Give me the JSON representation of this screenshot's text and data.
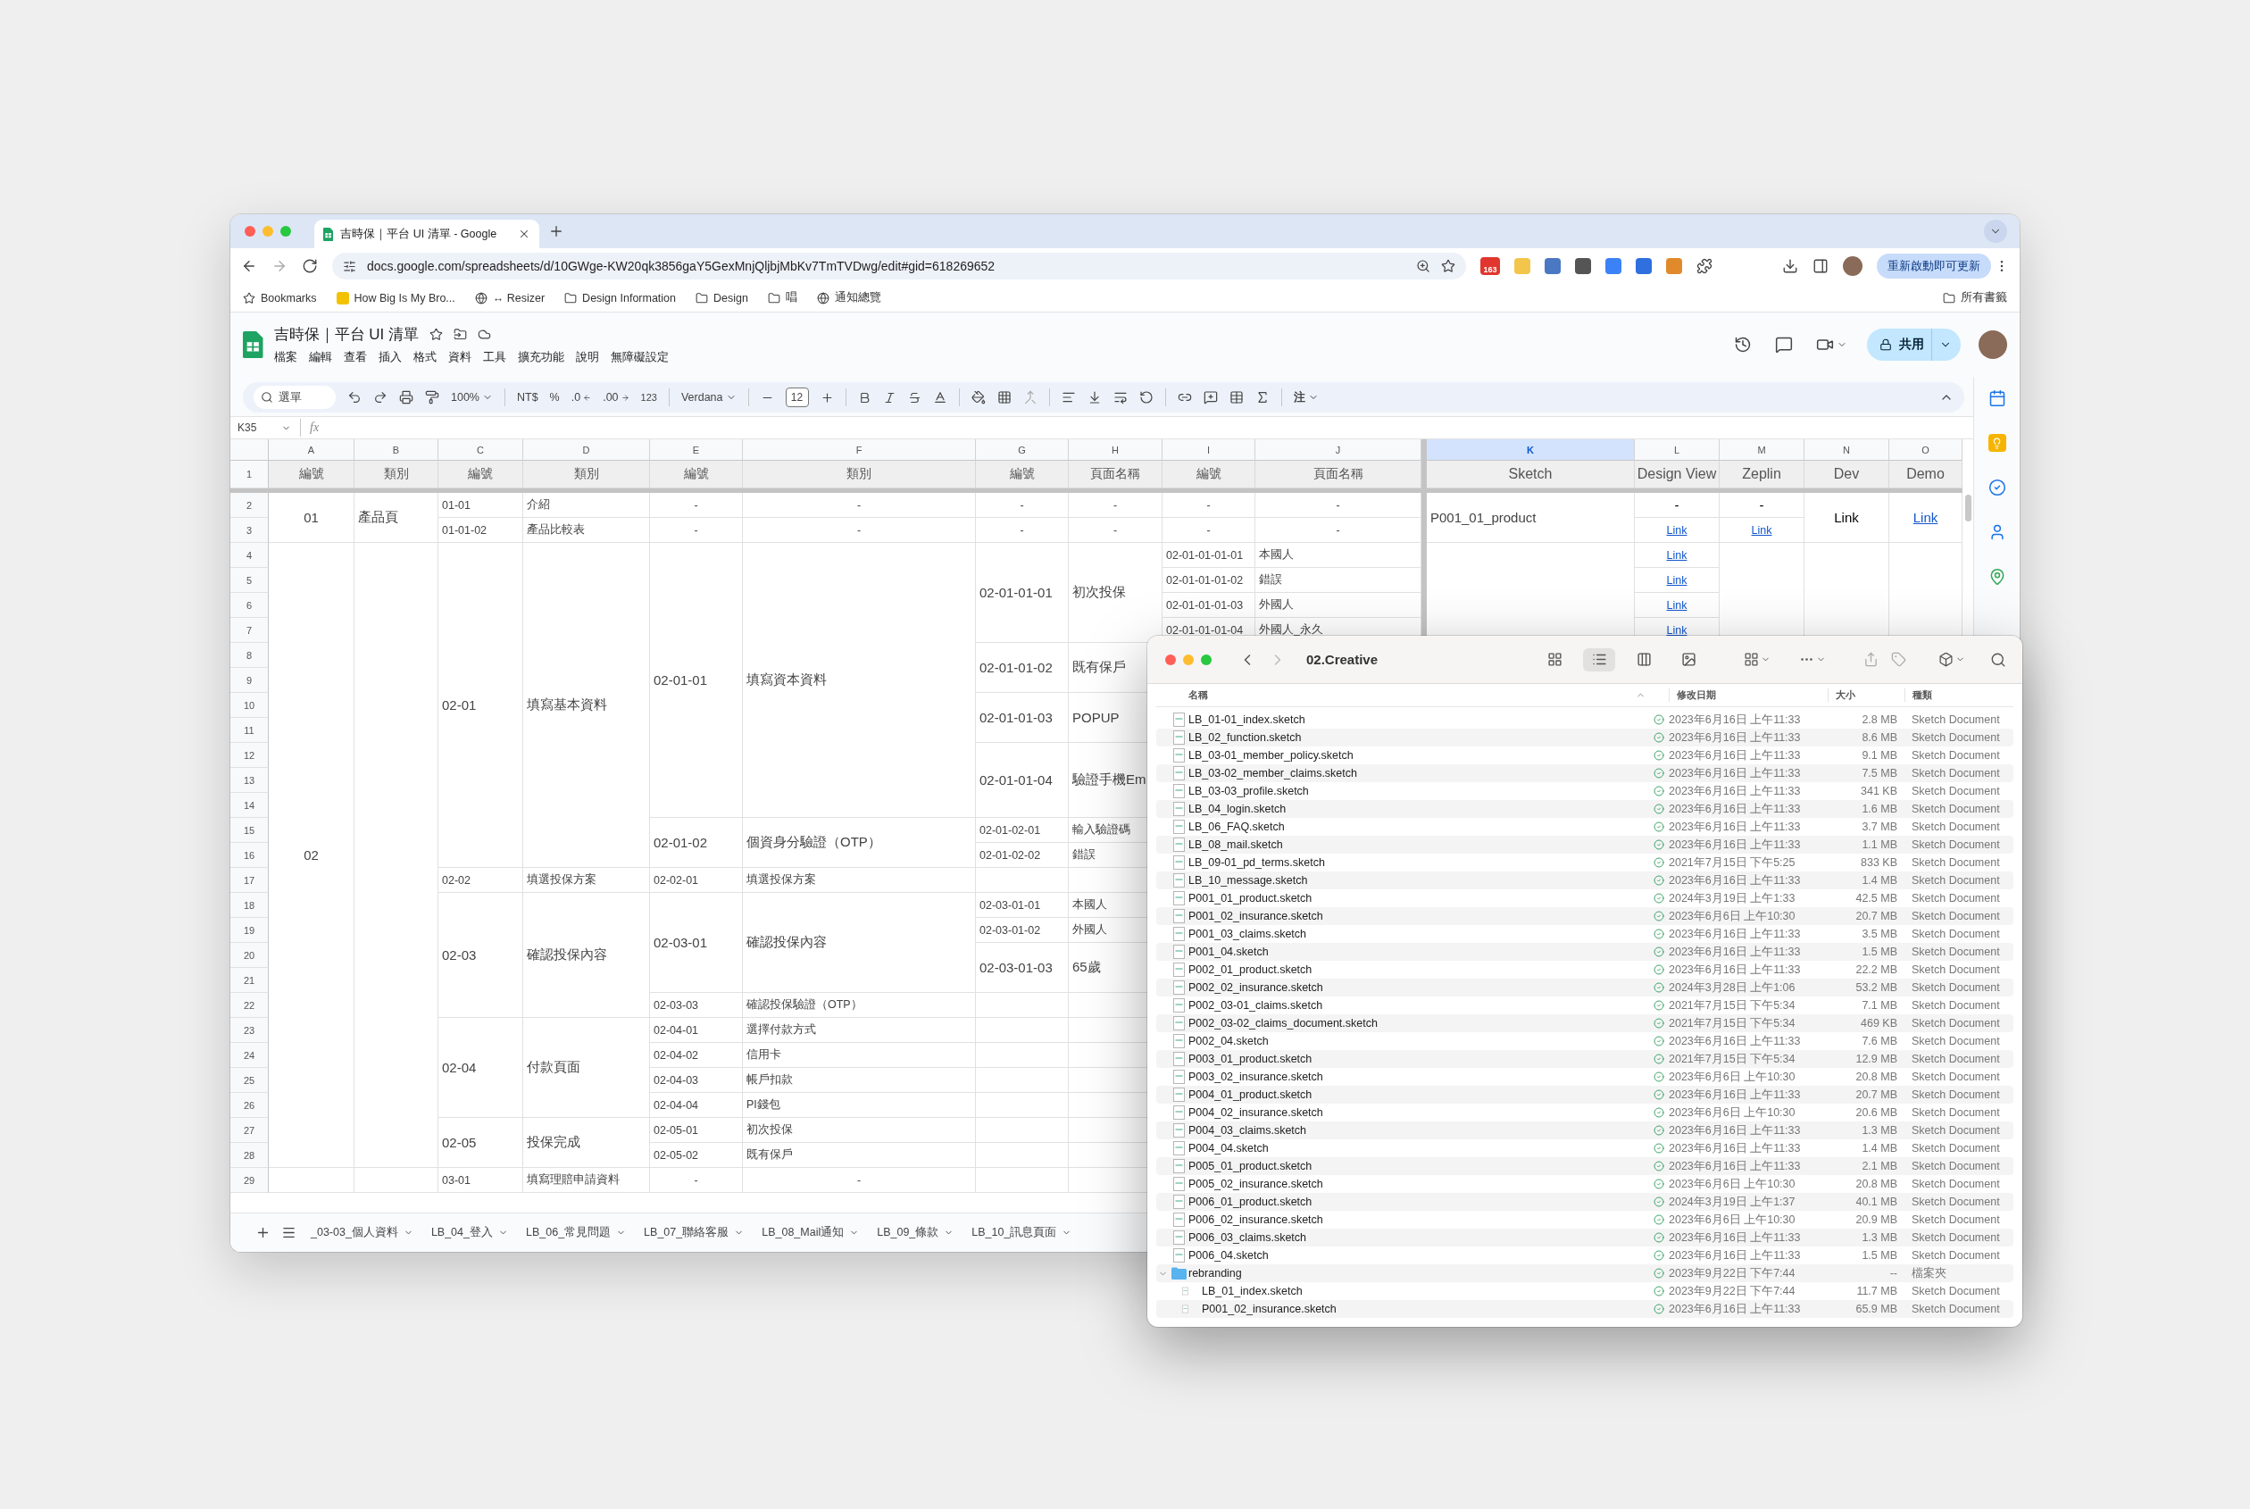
{
  "browser": {
    "tab": {
      "title": "吉時保｜平台 UI 清單 - Google"
    },
    "url": "docs.google.com/spreadsheets/d/10GWge-KW20qk3856gaY5GexMnjQljbjMbKv7TmTVDwg/edit#gid=618269652",
    "extension_badge": "163",
    "update_button": "重新啟動即可更新",
    "bookmarks": [
      {
        "label": "Bookmarks",
        "kind": "star"
      },
      {
        "label": "How Big Is My Bro...",
        "kind": "site"
      },
      {
        "label": "↔ Resizer",
        "kind": "globe"
      },
      {
        "label": "Design Information",
        "kind": "folder"
      },
      {
        "label": "Design",
        "kind": "folder"
      },
      {
        "label": "唱",
        "kind": "folder"
      },
      {
        "label": "通知總覽",
        "kind": "globe"
      }
    ],
    "all_bookmarks": "所有書籤"
  },
  "sheets": {
    "title": "吉時保｜平台 UI 清單",
    "menu": [
      "檔案",
      "編輯",
      "查看",
      "插入",
      "格式",
      "資料",
      "工具",
      "擴充功能",
      "說明",
      "無障礙設定"
    ],
    "share": "共用",
    "toolbar": {
      "search": "選單",
      "zoom": "100%",
      "currency": "NT$",
      "percent": "%",
      "decimal_less": ".0",
      "decimal_more": ".00",
      "number_format": "123",
      "font": "Verdana",
      "font_size": "12",
      "input_tool": "注"
    },
    "name_box": "K35",
    "formula_label": "fx",
    "row_numbers": [
      "1",
      "2",
      "3",
      "4",
      "5",
      "6",
      "7",
      "8",
      "9",
      "10",
      "11",
      "12",
      "13",
      "14",
      "15",
      "16",
      "17",
      "18",
      "19",
      "20",
      "21",
      "22",
      "23",
      "24",
      "25",
      "26",
      "27",
      "28",
      "29"
    ],
    "columns": [
      {
        "letter": "A",
        "selected": false,
        "header": "編號",
        "cells": [
          {
            "text": "01",
            "kind": "center"
          },
          {
            "kind": "merged"
          },
          {
            "text": "02",
            "kind": "center"
          },
          {
            "kind": "merged"
          },
          {
            "kind": "merged"
          },
          {
            "kind": "merged"
          },
          {
            "kind": "merged"
          },
          {
            "kind": "merged"
          },
          {
            "kind": "merged"
          },
          {
            "kind": "merged"
          },
          {
            "kind": "merged"
          },
          {
            "kind": "merged"
          },
          {
            "kind": "merged"
          },
          {
            "kind": "merged"
          },
          {
            "kind": "merged"
          },
          {
            "kind": "merged"
          },
          {
            "kind": "merged"
          },
          {
            "kind": "merged"
          },
          {
            "kind": "merged"
          },
          {
            "kind": "merged"
          },
          {
            "kind": "merged"
          },
          {
            "kind": "merged"
          },
          {
            "kind": "merged"
          },
          {
            "kind": "merged"
          },
          {
            "kind": "merged"
          },
          {
            "kind": "merged"
          },
          {
            "kind": "merged"
          },
          {
            "kind": "empty"
          }
        ]
      },
      {
        "letter": "B",
        "selected": false,
        "header": "類別",
        "cells": [
          {
            "text": "產品頁",
            "kind": "text"
          },
          {
            "kind": "merged"
          },
          {
            "kind": "empty"
          },
          {
            "kind": "merged"
          },
          {
            "kind": "merged"
          },
          {
            "kind": "merged"
          },
          {
            "kind": "merged"
          },
          {
            "kind": "merged"
          },
          {
            "kind": "merged"
          },
          {
            "kind": "merged"
          },
          {
            "kind": "merged"
          },
          {
            "kind": "merged"
          },
          {
            "kind": "merged"
          },
          {
            "kind": "merged"
          },
          {
            "kind": "merged"
          },
          {
            "kind": "merged"
          },
          {
            "kind": "merged"
          },
          {
            "kind": "merged"
          },
          {
            "kind": "merged"
          },
          {
            "kind": "merged"
          },
          {
            "kind": "merged"
          },
          {
            "kind": "merged"
          },
          {
            "kind": "merged"
          },
          {
            "kind": "merged"
          },
          {
            "kind": "merged"
          },
          {
            "kind": "merged"
          },
          {
            "kind": "merged"
          },
          {
            "kind": "empty"
          }
        ]
      },
      {
        "letter": "C",
        "selected": false,
        "header": "編號",
        "cells": [
          {
            "text": "01-01",
            "kind": "text"
          },
          {
            "text": "01-01-02",
            "kind": "text"
          },
          {
            "text": "02-01",
            "kind": "text"
          },
          {
            "kind": "merged"
          },
          {
            "kind": "merged"
          },
          {
            "kind": "merged"
          },
          {
            "kind": "merged"
          },
          {
            "kind": "merged"
          },
          {
            "kind": "merged"
          },
          {
            "kind": "merged"
          },
          {
            "kind": "merged"
          },
          {
            "kind": "merged"
          },
          {
            "kind": "merged"
          },
          {
            "kind": "merged"
          },
          {
            "kind": "merged"
          },
          {
            "text": "02-02",
            "kind": "text"
          },
          {
            "text": "02-03",
            "kind": "text"
          },
          {
            "kind": "merged"
          },
          {
            "kind": "merged"
          },
          {
            "kind": "merged"
          },
          {
            "kind": "merged"
          },
          {
            "text": "02-04",
            "kind": "text"
          },
          {
            "kind": "merged"
          },
          {
            "kind": "merged"
          },
          {
            "kind": "merged"
          },
          {
            "text": "02-05",
            "kind": "text"
          },
          {
            "kind": "merged"
          },
          {
            "text": "03-01",
            "kind": "text"
          }
        ]
      },
      {
        "letter": "D",
        "selected": false,
        "header": "類別",
        "cells": [
          {
            "text": "介紹",
            "kind": "text"
          },
          {
            "text": "產品比較表",
            "kind": "text"
          },
          {
            "text": "填寫基本資料",
            "kind": "text"
          },
          {
            "kind": "merged"
          },
          {
            "kind": "merged"
          },
          {
            "kind": "merged"
          },
          {
            "kind": "merged"
          },
          {
            "kind": "merged"
          },
          {
            "kind": "merged"
          },
          {
            "kind": "merged"
          },
          {
            "kind": "merged"
          },
          {
            "kind": "merged"
          },
          {
            "kind": "merged"
          },
          {
            "kind": "merged"
          },
          {
            "kind": "merged"
          },
          {
            "text": "填選投保方案",
            "kind": "text"
          },
          {
            "text": "確認投保內容",
            "kind": "text"
          },
          {
            "kind": "merged"
          },
          {
            "kind": "merged"
          },
          {
            "kind": "merged"
          },
          {
            "kind": "merged"
          },
          {
            "text": "付款頁面",
            "kind": "text"
          },
          {
            "kind": "merged"
          },
          {
            "kind": "merged"
          },
          {
            "kind": "merged"
          },
          {
            "text": "投保完成",
            "kind": "text"
          },
          {
            "kind": "merged"
          },
          {
            "text": "填寫理賠申請資料",
            "kind": "text"
          }
        ]
      },
      {
        "letter": "E",
        "selected": false,
        "header": "編號",
        "cells": [
          {
            "text": "-",
            "kind": "center"
          },
          {
            "text": "-",
            "kind": "center"
          },
          {
            "text": "02-01-01",
            "kind": "text"
          },
          {
            "kind": "merged"
          },
          {
            "kind": "merged"
          },
          {
            "kind": "merged"
          },
          {
            "kind": "merged"
          },
          {
            "kind": "merged"
          },
          {
            "kind": "merged"
          },
          {
            "kind": "merged"
          },
          {
            "kind": "merged"
          },
          {
            "kind": "merged"
          },
          {
            "kind": "merged"
          },
          {
            "text": "02-01-02",
            "kind": "text"
          },
          {
            "kind": "merged"
          },
          {
            "text": "02-02-01",
            "kind": "text"
          },
          {
            "text": "02-03-01",
            "kind": "text"
          },
          {
            "kind": "merged"
          },
          {
            "kind": "merged"
          },
          {
            "kind": "merged"
          },
          {
            "text": "02-03-03",
            "kind": "text"
          },
          {
            "text": "02-04-01",
            "kind": "text"
          },
          {
            "text": "02-04-02",
            "kind": "text"
          },
          {
            "text": "02-04-03",
            "kind": "text"
          },
          {
            "text": "02-04-04",
            "kind": "text"
          },
          {
            "text": "02-05-01",
            "kind": "text"
          },
          {
            "text": "02-05-02",
            "kind": "text"
          },
          {
            "text": "-",
            "kind": "center"
          }
        ]
      },
      {
        "letter": "F",
        "selected": false,
        "header": "類別",
        "cells": [
          {
            "text": "-",
            "kind": "center"
          },
          {
            "text": "-",
            "kind": "center"
          },
          {
            "text": "填寫資本資料",
            "kind": "text"
          },
          {
            "kind": "merged"
          },
          {
            "kind": "merged"
          },
          {
            "kind": "merged"
          },
          {
            "kind": "merged"
          },
          {
            "kind": "merged"
          },
          {
            "kind": "merged"
          },
          {
            "kind": "merged"
          },
          {
            "kind": "merged"
          },
          {
            "kind": "merged"
          },
          {
            "kind": "merged"
          },
          {
            "text": "個資身分驗證（OTP）",
            "kind": "text"
          },
          {
            "kind": "merged"
          },
          {
            "text": "填選投保方案",
            "kind": "text"
          },
          {
            "text": "確認投保內容",
            "kind": "text"
          },
          {
            "kind": "merged"
          },
          {
            "kind": "merged"
          },
          {
            "kind": "merged"
          },
          {
            "text": "確認投保驗證（OTP）",
            "kind": "text"
          },
          {
            "text": "選擇付款方式",
            "kind": "text"
          },
          {
            "text": "信用卡",
            "kind": "text"
          },
          {
            "text": "帳戶扣款",
            "kind": "text"
          },
          {
            "text": "PI錢包",
            "kind": "text"
          },
          {
            "text": "初次投保",
            "kind": "text"
          },
          {
            "text": "既有保戶",
            "kind": "text"
          },
          {
            "text": "-",
            "kind": "center"
          }
        ]
      },
      {
        "letter": "G",
        "selected": false,
        "header": "編號",
        "cells": [
          {
            "text": "-",
            "kind": "center"
          },
          {
            "text": "-",
            "kind": "center"
          },
          {
            "text": "02-01-01-01",
            "kind": "text"
          },
          {
            "kind": "merged"
          },
          {
            "kind": "merged"
          },
          {
            "kind": "merged"
          },
          {
            "text": "02-01-01-02",
            "kind": "text"
          },
          {
            "kind": "merged"
          },
          {
            "text": "02-01-01-03",
            "kind": "text"
          },
          {
            "kind": "merged"
          },
          {
            "text": "02-01-01-04",
            "kind": "text"
          },
          {
            "kind": "merged"
          },
          {
            "kind": "merged"
          },
          {
            "text": "02-01-02-01",
            "kind": "text"
          },
          {
            "text": "02-01-02-02",
            "kind": "text"
          },
          {
            "kind": "empty"
          },
          {
            "text": "02-03-01-01",
            "kind": "text"
          },
          {
            "text": "02-03-01-02",
            "kind": "text"
          },
          {
            "text": "02-03-01-03",
            "kind": "text"
          },
          {
            "kind": "merged"
          },
          {
            "kind": "empty"
          },
          {
            "kind": "empty"
          },
          {
            "kind": "empty"
          },
          {
            "kind": "empty"
          },
          {
            "kind": "empty"
          },
          {
            "kind": "empty"
          },
          {
            "kind": "empty"
          },
          {
            "kind": "empty"
          }
        ]
      },
      {
        "letter": "H",
        "selected": false,
        "header": "頁面名稱",
        "cells": [
          {
            "text": "-",
            "kind": "center"
          },
          {
            "text": "-",
            "kind": "center"
          },
          {
            "text": "初次投保",
            "kind": "text"
          },
          {
            "kind": "merged"
          },
          {
            "kind": "merged"
          },
          {
            "kind": "merged"
          },
          {
            "text": "既有保戶",
            "kind": "text"
          },
          {
            "kind": "merged"
          },
          {
            "text": "POPUP",
            "kind": "text"
          },
          {
            "kind": "merged"
          },
          {
            "text": "驗證手機Em",
            "kind": "text"
          },
          {
            "kind": "merged"
          },
          {
            "kind": "merged"
          },
          {
            "text": "輸入驗證碼",
            "kind": "text"
          },
          {
            "text": "錯誤",
            "kind": "text"
          },
          {
            "kind": "empty"
          },
          {
            "text": "本國人",
            "kind": "text"
          },
          {
            "text": "外國人",
            "kind": "text"
          },
          {
            "text": "65歲",
            "kind": "text"
          },
          {
            "kind": "merged"
          },
          {
            "kind": "empty"
          },
          {
            "kind": "empty"
          },
          {
            "kind": "empty"
          },
          {
            "kind": "empty"
          },
          {
            "kind": "empty"
          },
          {
            "kind": "empty"
          },
          {
            "kind": "empty"
          },
          {
            "kind": "empty"
          }
        ]
      },
      {
        "letter": "I",
        "selected": false,
        "header": "編號",
        "cells": [
          {
            "text": "-",
            "kind": "center"
          },
          {
            "text": "-",
            "kind": "center"
          },
          {
            "text": "02-01-01-01-01",
            "kind": "text"
          },
          {
            "text": "02-01-01-01-02",
            "kind": "text"
          },
          {
            "text": "02-01-01-01-03",
            "kind": "text"
          },
          {
            "text": "02-01-01-01-04",
            "kind": "text"
          }
        ]
      },
      {
        "letter": "J",
        "selected": false,
        "header": "頁面名稱",
        "cells": [
          {
            "text": "-",
            "kind": "center"
          },
          {
            "text": "-",
            "kind": "center"
          },
          {
            "text": "本國人",
            "kind": "text"
          },
          {
            "text": "錯誤",
            "kind": "text"
          },
          {
            "text": "外國人",
            "kind": "text"
          },
          {
            "text": "外國人_永久",
            "kind": "text"
          }
        ]
      },
      {
        "letter": "K",
        "selected": true,
        "header": "Sketch",
        "cells": [
          {
            "text": "P001_01_product",
            "kind": "text"
          },
          {
            "kind": "merged"
          },
          {
            "kind": "empty"
          },
          {
            "kind": "merged"
          },
          {
            "kind": "merged"
          },
          {
            "kind": "merged"
          }
        ]
      },
      {
        "letter": "L",
        "selected": false,
        "header": "Design View",
        "cells": [
          {
            "text": "-",
            "kind": "center"
          },
          {
            "text": "Link",
            "kind": "link"
          },
          {
            "text": "Link",
            "kind": "link"
          },
          {
            "text": "Link",
            "kind": "link"
          },
          {
            "text": "Link",
            "kind": "link"
          },
          {
            "text": "Link",
            "kind": "link"
          }
        ]
      },
      {
        "letter": "M",
        "selected": false,
        "header": "Zeplin",
        "cells": [
          {
            "text": "-",
            "kind": "center"
          },
          {
            "text": "Link",
            "kind": "link"
          },
          {
            "kind": "empty"
          },
          {
            "kind": "merged"
          },
          {
            "kind": "merged"
          },
          {
            "kind": "merged"
          }
        ]
      },
      {
        "letter": "N",
        "selected": false,
        "header": "Dev",
        "cells": [
          {
            "text": "Link",
            "kind": "center"
          },
          {
            "kind": "merged"
          },
          {
            "kind": "empty"
          },
          {
            "kind": "merged"
          },
          {
            "kind": "merged"
          },
          {
            "kind": "merged"
          }
        ]
      },
      {
        "letter": "O",
        "selected": false,
        "header": "Demo",
        "cells": [
          {
            "text": "Link",
            "kind": "link"
          },
          {
            "kind": "merged"
          },
          {
            "kind": "empty"
          },
          {
            "kind": "merged"
          },
          {
            "kind": "merged"
          },
          {
            "kind": "merged"
          }
        ]
      }
    ],
    "sheet_tabs": [
      {
        "label": "_03-03_個人資料",
        "selected": false
      },
      {
        "label": "LB_04_登入",
        "selected": false
      },
      {
        "label": "LB_06_常見問題",
        "selected": false
      },
      {
        "label": "LB_07_聯絡客服",
        "selected": false
      },
      {
        "label": "LB_08_Mail通知",
        "selected": false
      },
      {
        "label": "LB_09_條款",
        "selected": false
      },
      {
        "label": "LB_10_訊息頁面",
        "selected": false
      }
    ]
  },
  "finder": {
    "title": "02.Creative",
    "back": {
      "disabled": false
    },
    "forward": {
      "disabled": true
    },
    "views": [
      {
        "kind": "icons",
        "selected": false
      },
      {
        "kind": "list",
        "selected": true
      },
      {
        "kind": "columns",
        "selected": false
      },
      {
        "kind": "gallery",
        "selected": false
      }
    ],
    "headers": {
      "name": "名稱",
      "date": "修改日期",
      "size": "大小",
      "type": "種類"
    },
    "items": [
      {
        "name": "LB_01-01_index.sketch",
        "date": "2023年6月16日 上午11:33",
        "size": "2.8 MB",
        "type": "Sketch Document",
        "kind": "file"
      },
      {
        "name": "LB_02_function.sketch",
        "date": "2023年6月16日 上午11:33",
        "size": "8.6 MB",
        "type": "Sketch Document",
        "kind": "file"
      },
      {
        "name": "LB_03-01_member_policy.sketch",
        "date": "2023年6月16日 上午11:33",
        "size": "9.1 MB",
        "type": "Sketch Document",
        "kind": "file"
      },
      {
        "name": "LB_03-02_member_claims.sketch",
        "date": "2023年6月16日 上午11:33",
        "size": "7.5 MB",
        "type": "Sketch Document",
        "kind": "file"
      },
      {
        "name": "LB_03-03_profile.sketch",
        "date": "2023年6月16日 上午11:33",
        "size": "341 KB",
        "type": "Sketch Document",
        "kind": "file"
      },
      {
        "name": "LB_04_login.sketch",
        "date": "2023年6月16日 上午11:33",
        "size": "1.6 MB",
        "type": "Sketch Document",
        "kind": "file"
      },
      {
        "name": "LB_06_FAQ.sketch",
        "date": "2023年6月16日 上午11:33",
        "size": "3.7 MB",
        "type": "Sketch Document",
        "kind": "file"
      },
      {
        "name": "LB_08_mail.sketch",
        "date": "2023年6月16日 上午11:33",
        "size": "1.1 MB",
        "type": "Sketch Document",
        "kind": "file"
      },
      {
        "name": "LB_09-01_pd_terms.sketch",
        "date": "2021年7月15日 下午5:25",
        "size": "833 KB",
        "type": "Sketch Document",
        "kind": "file"
      },
      {
        "name": "LB_10_message.sketch",
        "date": "2023年6月16日 上午11:33",
        "size": "1.4 MB",
        "type": "Sketch Document",
        "kind": "file"
      },
      {
        "name": "P001_01_product.sketch",
        "date": "2024年3月19日 上午1:33",
        "size": "42.5 MB",
        "type": "Sketch Document",
        "kind": "file"
      },
      {
        "name": "P001_02_insurance.sketch",
        "date": "2023年6月6日 上午10:30",
        "size": "20.7 MB",
        "type": "Sketch Document",
        "kind": "file"
      },
      {
        "name": "P001_03_claims.sketch",
        "date": "2023年6月16日 上午11:33",
        "size": "3.5 MB",
        "type": "Sketch Document",
        "kind": "file"
      },
      {
        "name": "P001_04.sketch",
        "date": "2023年6月16日 上午11:33",
        "size": "1.5 MB",
        "type": "Sketch Document",
        "kind": "file"
      },
      {
        "name": "P002_01_product.sketch",
        "date": "2023年6月16日 上午11:33",
        "size": "22.2 MB",
        "type": "Sketch Document",
        "kind": "file"
      },
      {
        "name": "P002_02_insurance.sketch",
        "date": "2024年3月28日 上午1:06",
        "size": "53.2 MB",
        "type": "Sketch Document",
        "kind": "file"
      },
      {
        "name": "P002_03-01_claims.sketch",
        "date": "2021年7月15日 下午5:34",
        "size": "7.1 MB",
        "type": "Sketch Document",
        "kind": "file"
      },
      {
        "name": "P002_03-02_claims_document.sketch",
        "date": "2021年7月15日 下午5:34",
        "size": "469 KB",
        "type": "Sketch Document",
        "kind": "file"
      },
      {
        "name": "P002_04.sketch",
        "date": "2023年6月16日 上午11:33",
        "size": "7.6 MB",
        "type": "Sketch Document",
        "kind": "file"
      },
      {
        "name": "P003_01_product.sketch",
        "date": "2021年7月15日 下午5:34",
        "size": "12.9 MB",
        "type": "Sketch Document",
        "kind": "file"
      },
      {
        "name": "P003_02_insurance.sketch",
        "date": "2023年6月6日 上午10:30",
        "size": "20.8 MB",
        "type": "Sketch Document",
        "kind": "file"
      },
      {
        "name": "P004_01_product.sketch",
        "date": "2023年6月16日 上午11:33",
        "size": "20.7 MB",
        "type": "Sketch Document",
        "kind": "file"
      },
      {
        "name": "P004_02_insurance.sketch",
        "date": "2023年6月6日 上午10:30",
        "size": "20.6 MB",
        "type": "Sketch Document",
        "kind": "file"
      },
      {
        "name": "P004_03_claims.sketch",
        "date": "2023年6月16日 上午11:33",
        "size": "1.3 MB",
        "type": "Sketch Document",
        "kind": "file"
      },
      {
        "name": "P004_04.sketch",
        "date": "2023年6月16日 上午11:33",
        "size": "1.4 MB",
        "type": "Sketch Document",
        "kind": "file"
      },
      {
        "name": "P005_01_product.sketch",
        "date": "2023年6月16日 上午11:33",
        "size": "2.1 MB",
        "type": "Sketch Document",
        "kind": "file"
      },
      {
        "name": "P005_02_insurance.sketch",
        "date": "2023年6月6日 上午10:30",
        "size": "20.8 MB",
        "type": "Sketch Document",
        "kind": "file"
      },
      {
        "name": "P006_01_product.sketch",
        "date": "2024年3月19日 上午1:37",
        "size": "40.1 MB",
        "type": "Sketch Document",
        "kind": "file"
      },
      {
        "name": "P006_02_insurance.sketch",
        "date": "2023年6月6日 上午10:30",
        "size": "20.9 MB",
        "type": "Sketch Document",
        "kind": "file"
      },
      {
        "name": "P006_03_claims.sketch",
        "date": "2023年6月16日 上午11:33",
        "size": "1.3 MB",
        "type": "Sketch Document",
        "kind": "file"
      },
      {
        "name": "P006_04.sketch",
        "date": "2023年6月16日 上午11:33",
        "size": "1.5 MB",
        "type": "Sketch Document",
        "kind": "file"
      },
      {
        "name": "rebranding",
        "date": "2023年9月22日 下午7:44",
        "size": "--",
        "type": "檔案夾",
        "kind": "folder",
        "expanded": true,
        "children": [
          {
            "name": "LB_01_index.sketch",
            "date": "2023年9月22日 下午7:44",
            "size": "11.7 MB",
            "type": "Sketch Document",
            "kind": "file"
          },
          {
            "name": "P001_02_insurance.sketch",
            "date": "2023年6月16日 上午11:33",
            "size": "65.9 MB",
            "type": "Sketch Document",
            "kind": "file"
          }
        ]
      }
    ]
  }
}
